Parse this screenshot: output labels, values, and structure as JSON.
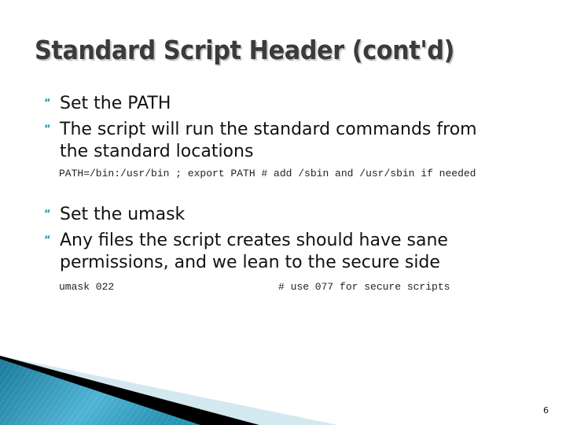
{
  "slide": {
    "title": "Standard Script Header (cont'd)",
    "page_number": "6",
    "accent_color": "#2b8fb0",
    "bullet_icon": "quote-bullet-icon",
    "sections": [
      {
        "bullets": [
          "Set the PATH",
          "The script will run the standard commands from",
          "the standard locations"
        ],
        "code": "PATH=/bin:/usr/bin ; export PATH # add /sbin and /usr/sbin if needed"
      },
      {
        "bullets": [
          "Set the umask",
          "Any files the script creates should have sane",
          "permissions, and we lean to the secure side"
        ],
        "code_left": "umask 022",
        "code_right": "# use 077 for secure scripts"
      }
    ]
  }
}
